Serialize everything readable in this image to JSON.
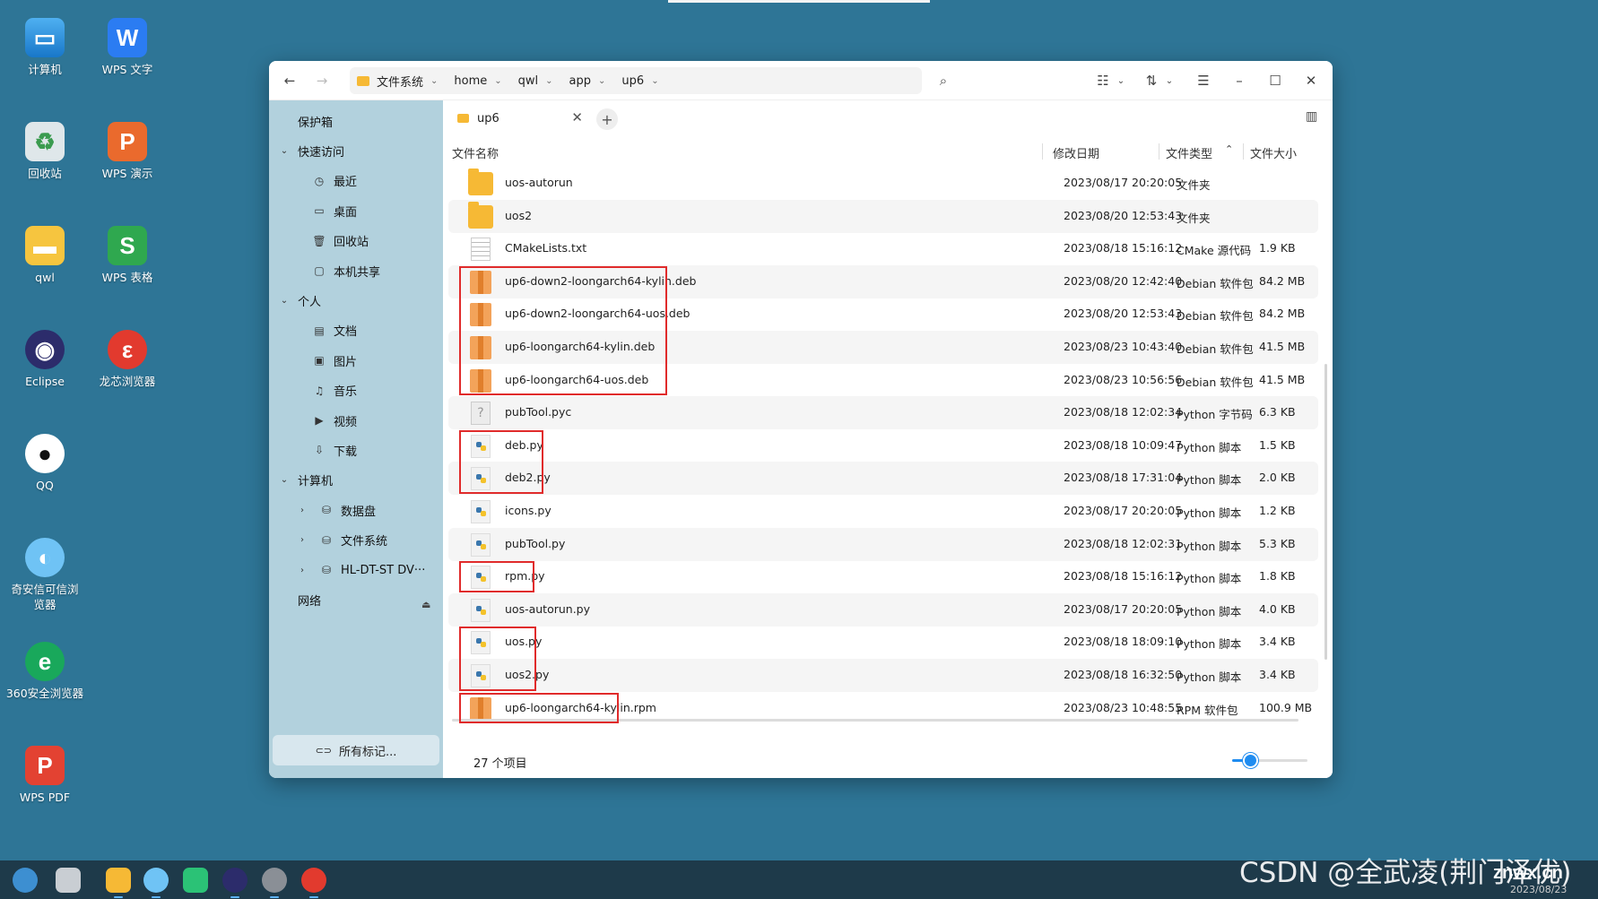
{
  "desktop": {
    "icons": [
      {
        "label": "计算机",
        "icon": "computer-icon"
      },
      {
        "label": "WPS 文字",
        "icon": "wps-writer-icon"
      },
      {
        "label": "回收站",
        "icon": "trash-icon"
      },
      {
        "label": "WPS 演示",
        "icon": "wps-presentation-icon"
      },
      {
        "label": "qwl",
        "icon": "home-folder-icon"
      },
      {
        "label": "WPS 表格",
        "icon": "wps-spreadsheet-icon"
      },
      {
        "label": "Eclipse",
        "icon": "eclipse-icon"
      },
      {
        "label": "龙芯浏览器",
        "icon": "loongson-browser-icon"
      },
      {
        "label": "QQ",
        "icon": "qq-icon"
      },
      {
        "label": "奇安信可信浏览器",
        "icon": "qianxin-browser-icon"
      },
      {
        "label": "360安全浏览器",
        "icon": "360-browser-icon"
      },
      {
        "label": "WPS PDF",
        "icon": "wps-pdf-icon"
      }
    ]
  },
  "titlebar": {
    "back": "←",
    "forward": "→",
    "breadcrumb": [
      "文件系统",
      "home",
      "qwl",
      "app",
      "up6"
    ],
    "search_icon": "⌕",
    "view_icon": "☷",
    "sort_icon": "⇅",
    "menu_icon": "☰",
    "minimize": "–",
    "maximize": "☐",
    "close": "✕"
  },
  "sidebar": {
    "items": [
      {
        "label": "保护箱",
        "level": 0,
        "expander": "",
        "icon": ""
      },
      {
        "label": "快速访问",
        "level": 0,
        "expander": "⌄",
        "icon": ""
      },
      {
        "label": "最近",
        "level": 1,
        "expander": "",
        "icon": "◷"
      },
      {
        "label": "桌面",
        "level": 1,
        "expander": "",
        "icon": "▭"
      },
      {
        "label": "回收站",
        "level": 1,
        "expander": "",
        "icon": "🗑"
      },
      {
        "label": "本机共享",
        "level": 1,
        "expander": "",
        "icon": "▢"
      },
      {
        "label": "个人",
        "level": 0,
        "expander": "⌄",
        "icon": ""
      },
      {
        "label": "文档",
        "level": 1,
        "expander": "",
        "icon": "▤"
      },
      {
        "label": "图片",
        "level": 1,
        "expander": "",
        "icon": "▣"
      },
      {
        "label": "音乐",
        "level": 1,
        "expander": "",
        "icon": "♫"
      },
      {
        "label": "视频",
        "level": 1,
        "expander": "",
        "icon": "▶"
      },
      {
        "label": "下载",
        "level": 1,
        "expander": "",
        "icon": "⇩"
      },
      {
        "label": "计算机",
        "level": 0,
        "expander": "⌄",
        "icon": ""
      },
      {
        "label": "数据盘",
        "level": 1,
        "expander": "›",
        "icon": "⛁"
      },
      {
        "label": "文件系统",
        "level": 1,
        "expander": "›",
        "icon": "⛁"
      },
      {
        "label": "HL-DT-ST DV···",
        "level": 1,
        "expander": "›",
        "icon": "⛁"
      },
      {
        "label": "网络",
        "level": 0,
        "expander": "",
        "icon": ""
      }
    ],
    "eject": "⏏",
    "all_tags": "所有标记..."
  },
  "tab": {
    "label": "up6",
    "close": "✕",
    "add": "+"
  },
  "columns": {
    "name": "文件名称",
    "date": "修改日期",
    "type": "文件类型",
    "size": "文件大小",
    "sort_indicator": "⌃"
  },
  "files": [
    {
      "name": "uos-autorun",
      "date": "2023/08/17 20:20:05",
      "type": "文件夹",
      "size": "",
      "kind": "folder"
    },
    {
      "name": "uos2",
      "date": "2023/08/20 12:53:43",
      "type": "文件夹",
      "size": "",
      "kind": "folder"
    },
    {
      "name": "CMakeLists.txt",
      "date": "2023/08/18 15:16:12",
      "type": "CMake 源代码",
      "size": "1.9 KB",
      "kind": "text"
    },
    {
      "name": "up6-down2-loongarch64-kylin.deb",
      "date": "2023/08/20 12:42:40",
      "type": "Debian 软件包",
      "size": "84.2 MB",
      "kind": "deb"
    },
    {
      "name": "up6-down2-loongarch64-uos.deb",
      "date": "2023/08/20 12:53:43",
      "type": "Debian 软件包",
      "size": "84.2 MB",
      "kind": "deb"
    },
    {
      "name": "up6-loongarch64-kylin.deb",
      "date": "2023/08/23 10:43:40",
      "type": "Debian 软件包",
      "size": "41.5 MB",
      "kind": "deb"
    },
    {
      "name": "up6-loongarch64-uos.deb",
      "date": "2023/08/23 10:56:56",
      "type": "Debian 软件包",
      "size": "41.5 MB",
      "kind": "deb"
    },
    {
      "name": "pubTool.pyc",
      "date": "2023/08/18 12:02:34",
      "type": "Python 字节码",
      "size": "6.3 KB",
      "kind": "unknown"
    },
    {
      "name": "deb.py",
      "date": "2023/08/18 10:09:47",
      "type": "Python 脚本",
      "size": "1.5 KB",
      "kind": "py"
    },
    {
      "name": "deb2.py",
      "date": "2023/08/18 17:31:04",
      "type": "Python 脚本",
      "size": "2.0 KB",
      "kind": "py"
    },
    {
      "name": "icons.py",
      "date": "2023/08/17 20:20:05",
      "type": "Python 脚本",
      "size": "1.2 KB",
      "kind": "py"
    },
    {
      "name": "pubTool.py",
      "date": "2023/08/18 12:02:31",
      "type": "Python 脚本",
      "size": "5.3 KB",
      "kind": "py"
    },
    {
      "name": "rpm.py",
      "date": "2023/08/18 15:16:12",
      "type": "Python 脚本",
      "size": "1.8 KB",
      "kind": "py"
    },
    {
      "name": "uos-autorun.py",
      "date": "2023/08/17 20:20:05",
      "type": "Python 脚本",
      "size": "4.0 KB",
      "kind": "py"
    },
    {
      "name": "uos.py",
      "date": "2023/08/18 18:09:10",
      "type": "Python 脚本",
      "size": "3.4 KB",
      "kind": "py"
    },
    {
      "name": "uos2.py",
      "date": "2023/08/18 16:32:50",
      "type": "Python 脚本",
      "size": "3.4 KB",
      "kind": "py"
    },
    {
      "name": "up6-loongarch64-kylin.rpm",
      "date": "2023/08/23 10:48:55",
      "type": "RPM 软件包",
      "size": "100.9 MB",
      "kind": "deb"
    }
  ],
  "status": {
    "item_count": "27 个项目",
    "zoom_level": 0.24
  },
  "watermark": {
    "text": "CSDN @全武凌(荆门泽优)",
    "site": "znwx.cn",
    "date": "2023/08/23"
  },
  "colors": {
    "desktop_bg": "#2e7596",
    "sidebar_bg": "#b2d1dd",
    "highlight_border": "#e02b2b",
    "accent": "#1f8cf0"
  }
}
